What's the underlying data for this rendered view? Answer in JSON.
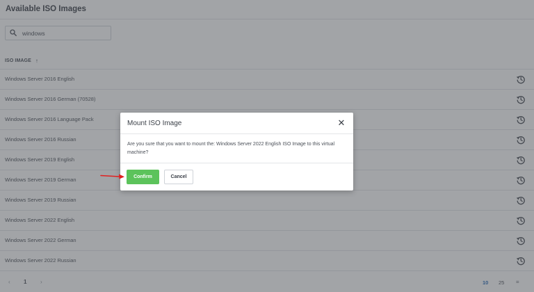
{
  "page": {
    "title": "Available ISO Images"
  },
  "search": {
    "value": "windows",
    "icon": "search-icon"
  },
  "table": {
    "column_header": "ISO IMAGE",
    "sort_indicator": "↑",
    "action_icon": "mount-history-icon",
    "rows": [
      {
        "name": "Windows Server 2016 English"
      },
      {
        "name": "Windows Server 2016 German (70528)"
      },
      {
        "name": "Windows Server 2016 Language Pack"
      },
      {
        "name": "Windows Server 2016 Russian"
      },
      {
        "name": "Windows Server 2019 English"
      },
      {
        "name": "Windows Server 2019 German"
      },
      {
        "name": "Windows Server 2019 Russian"
      },
      {
        "name": "Windows Server 2022 English"
      },
      {
        "name": "Windows Server 2022 German"
      },
      {
        "name": "Windows Server 2022 Russian"
      }
    ]
  },
  "pagination": {
    "prev": "‹",
    "current_page": "1",
    "next": "›",
    "page_sizes": [
      "10",
      "25"
    ],
    "selected_page_size": "10",
    "all_icon": "="
  },
  "modal": {
    "title": "Mount ISO Image",
    "close": "✕",
    "message": "Are you sure that you want to mount the: Windows Server 2022 English ISO Image to this virtual machine?",
    "confirm_label": "Confirm",
    "cancel_label": "Cancel"
  },
  "colors": {
    "confirm_button": "#5cc35b",
    "selected_page_size": "#2b6cb8",
    "annotation_arrow": "#e02020"
  }
}
